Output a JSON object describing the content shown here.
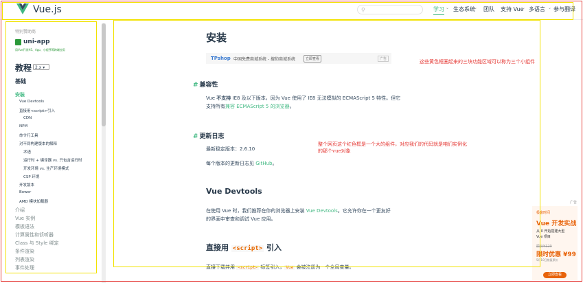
{
  "header": {
    "brand": "Vue.js",
    "search_placeholder": "",
    "nav": [
      "学习",
      "生态系统",
      "团队",
      "支持 Vue",
      "多语言",
      "参与翻译"
    ]
  },
  "sidebar": {
    "sponsor_label": "特别赞助商",
    "uniapp_title": "uni-app",
    "uniapp_sub": "用Vue开发H5、App、小程序等跨端应用",
    "guide_title": "教程",
    "version": "2.x",
    "basics": "基础",
    "items": [
      {
        "label": "安装",
        "level": 0,
        "active": true
      },
      {
        "label": "Vue Devtools",
        "level": 1
      },
      {
        "label": "直接用<script>引入",
        "level": 1
      },
      {
        "label": "CDN",
        "level": 2
      },
      {
        "label": "NPM",
        "level": 1
      },
      {
        "label": "命令行工具",
        "level": 1
      },
      {
        "label": "对不同构建版本的解释",
        "level": 1
      },
      {
        "label": "术语",
        "level": 2
      },
      {
        "label": "运行时 + 编译器 vs. 只包含运行时",
        "level": 2
      },
      {
        "label": "开发环境 vs. 生产环境模式",
        "level": 2
      },
      {
        "label": "CSP 环境",
        "level": 2
      },
      {
        "label": "开发版本",
        "level": 1
      },
      {
        "label": "Bower",
        "level": 1
      },
      {
        "label": "AMD 模块加载器",
        "level": 1
      },
      {
        "label": "介绍",
        "level": 0
      },
      {
        "label": "Vue 实例",
        "level": 0
      },
      {
        "label": "模板语法",
        "level": 0
      },
      {
        "label": "计算属性和侦听器",
        "level": 0
      },
      {
        "label": "Class 与 Style 绑定",
        "level": 0
      },
      {
        "label": "条件渲染",
        "level": 0
      },
      {
        "label": "列表渲染",
        "level": 0
      },
      {
        "label": "事件处理",
        "level": 0
      }
    ]
  },
  "main": {
    "title": "安装",
    "banner": {
      "brand": "TPshop",
      "text": "中国免费商城系统 - 搜豹商城系统",
      "button": "立即查看",
      "ad_tag": "广告"
    },
    "compat_title": "兼容性",
    "compat_text_1a": "Vue ",
    "compat_text_1b": "不支持",
    "compat_text_1c": " IE8 及以下版本，因为 Vue 使用了 IE8 无法模拟的 ECMAScript 5 特性。但它",
    "compat_text_2a": "支持所有",
    "compat_text_2b": "兼容 ECMAScript 5 的浏览器",
    "compat_text_2c": "。",
    "changelog_title": "更新日志",
    "latest_label": "最新稳定版本：2.6.10",
    "changelog_text_a": "每个版本的更新日志见 ",
    "changelog_text_b": "GitHub",
    "changelog_text_c": "。",
    "devtools_title": "Vue Devtools",
    "devtools_text_1a": "在使用 Vue 时，我们推荐在你的浏览器上安装 ",
    "devtools_text_1b": "Vue Devtools",
    "devtools_text_1c": "。它允许你在一个更友好",
    "devtools_text_2": "的界面中审查和调试 Vue 应用。",
    "script_title_a": "直接用 ",
    "script_title_code": "<script>",
    "script_title_b": " 引入",
    "script_text_a": "直接下载并用 ",
    "script_text_code1": "<script>",
    "script_text_b": " 标签引入，",
    "script_text_code2": "Vue",
    "script_text_c": " 会被注册为一个全局变量。"
  },
  "annotations": {
    "note1": "这些黄色框圈起来的三块功能区域可以称为三个小组件",
    "note2a": "整个网页这个红色框是一个大的组件，对应我们的代码就是咱们实例化",
    "note2b": "的那个vue对象"
  },
  "ad": {
    "tag": "广告",
    "brand": "极客时间",
    "title": "Vue 开发实战",
    "sub1": "从 0 开始搭建大型",
    "sub2": "Vue 项目",
    "old_price": "原价¥129",
    "promo": "限时优惠 ¥99",
    "note": "5月10日恢复原价",
    "button": "立即查看"
  },
  "colors": {
    "accent": "#42b983",
    "annotation_red": "#e53935",
    "annotation_yellow": "#f2e200"
  }
}
